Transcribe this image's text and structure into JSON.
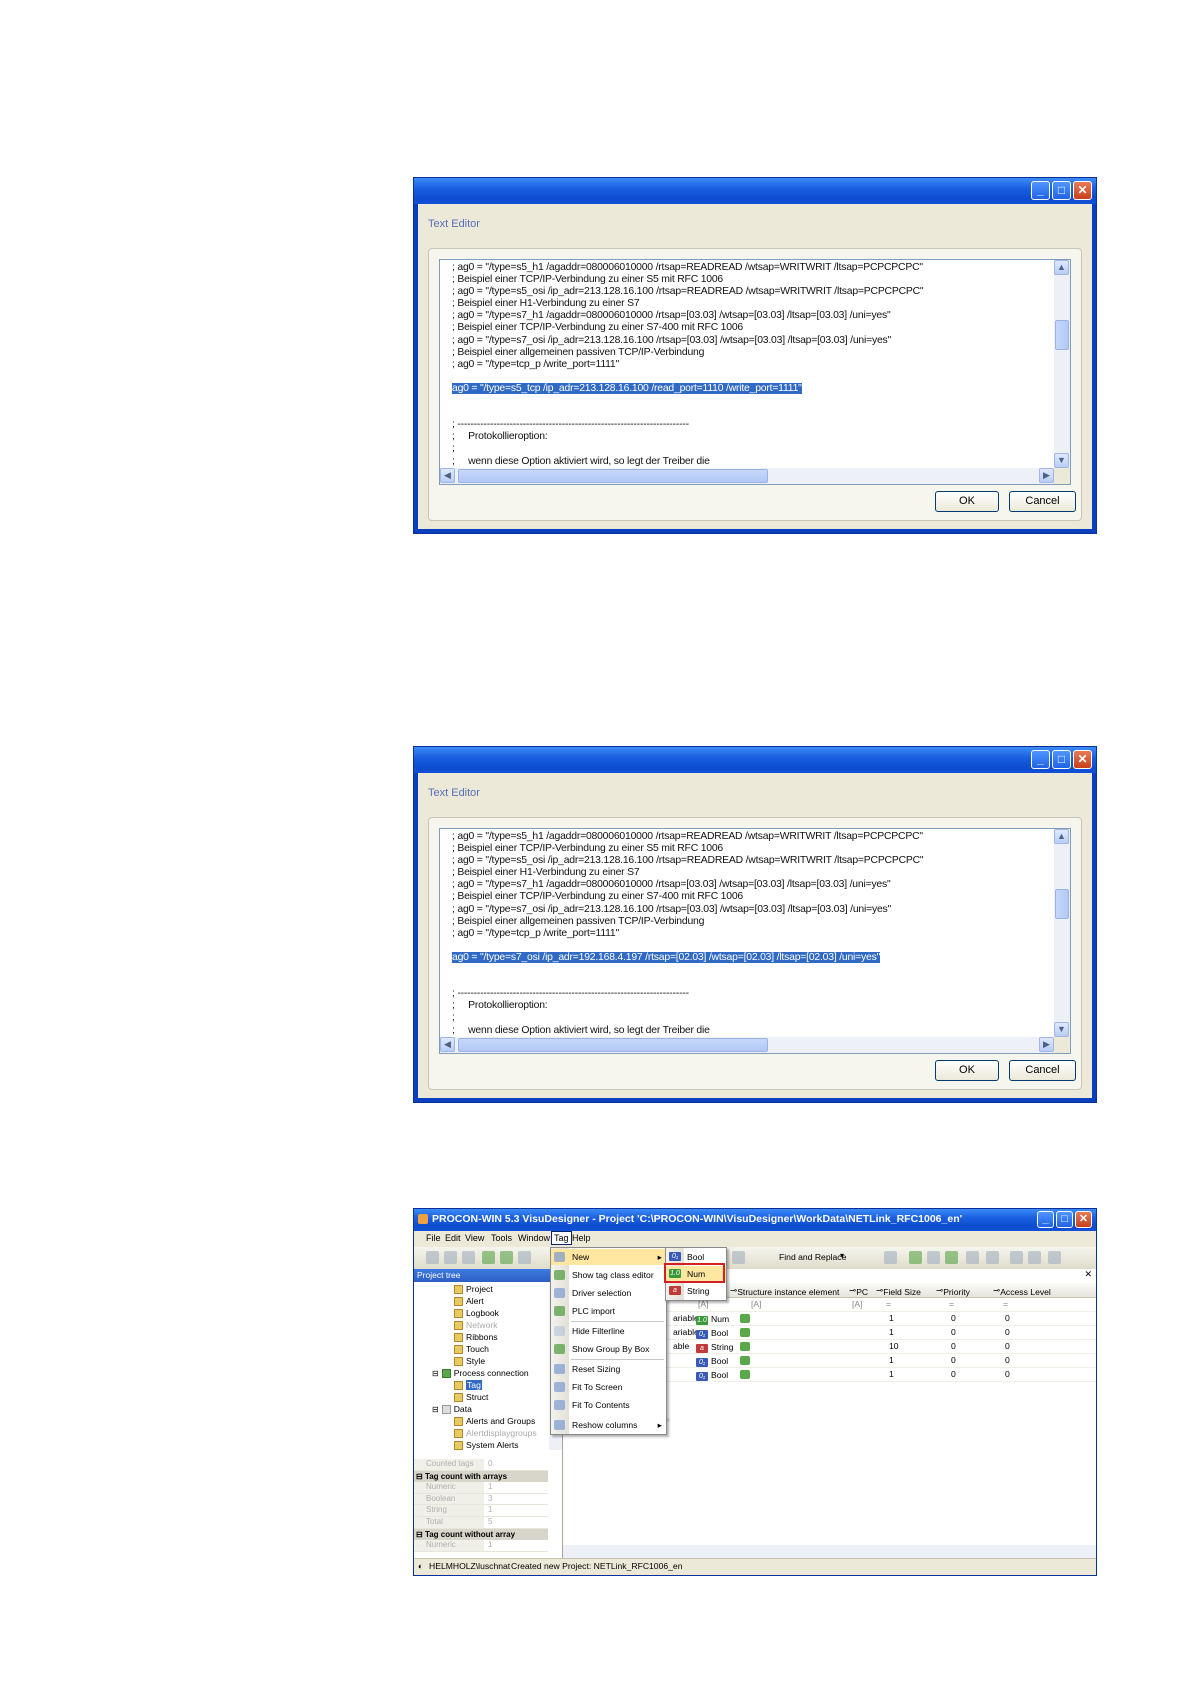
{
  "editor_dialogs": [
    {
      "dialog_title": "Text Editor",
      "lines": [
        "; ag0 = \"/type=s5_h1 /agaddr=080006010000 /rtsap=READREAD /wtsap=WRITWRIT /ltsap=PCPCPCPC\"",
        "; Beispiel einer TCP/IP-Verbindung zu einer S5 mit RFC 1006",
        "; ag0 = \"/type=s5_osi /ip_adr=213.128.16.100 /rtsap=READREAD /wtsap=WRITWRIT /ltsap=PCPCPCPC\"",
        "; Beispiel einer H1-Verbindung zu einer S7",
        "; ag0 = \"/type=s7_h1 /agaddr=080006010000 /rtsap=[03.03] /wtsap=[03.03] /ltsap=[03.03] /uni=yes\"",
        "; Beispiel einer TCP/IP-Verbindung zu einer S7-400 mit RFC 1006",
        "; ag0 = \"/type=s7_osi /ip_adr=213.128.16.100 /rtsap=[03.03] /wtsap=[03.03] /ltsap=[03.03] /uni=yes\"",
        "; Beispiel einer allgemeinen passiven TCP/IP-Verbindung",
        "; ag0 = \"/type=tcp_p /write_port=1111\""
      ],
      "selected_line": "ag0 = \"/type=s5_tcp /ip_adr=213.128.16.100 /read_port=1110 /write_port=1111\"",
      "separator": "; -----------------------------------------------------------------------",
      "tail_lines": [
        ";     Protokollieroption:",
        ";",
        ";     wenn diese Option aktiviert wird, so legt der Treiber die"
      ],
      "ok_label": "OK",
      "cancel_label": "Cancel"
    },
    {
      "dialog_title": "Text Editor",
      "lines": [
        "; ag0 = \"/type=s5_h1 /agaddr=080006010000 /rtsap=READREAD /wtsap=WRITWRIT /ltsap=PCPCPCPC\"",
        "; Beispiel einer TCP/IP-Verbindung zu einer S5 mit RFC 1006",
        "; ag0 = \"/type=s5_osi /ip_adr=213.128.16.100 /rtsap=READREAD /wtsap=WRITWRIT /ltsap=PCPCPCPC\"",
        "; Beispiel einer H1-Verbindung zu einer S7",
        "; ag0 = \"/type=s7_h1 /agaddr=080006010000 /rtsap=[03.03] /wtsap=[03.03] /ltsap=[03.03] /uni=yes\"",
        "; Beispiel einer TCP/IP-Verbindung zu einer S7-400 mit RFC 1006",
        "; ag0 = \"/type=s7_osi /ip_adr=213.128.16.100 /rtsap=[03.03] /wtsap=[03.03] /ltsap=[03.03] /uni=yes\"",
        "; Beispiel einer allgemeinen passiven TCP/IP-Verbindung",
        "; ag0 = \"/type=tcp_p /write_port=1111\""
      ],
      "selected_line": "ag0 = \"/type=s7_osi /ip_adr=192.168.4.197 /rtsap=[02.03] /wtsap=[02.03] /ltsap=[02.03] /uni=yes\"",
      "separator": "; -----------------------------------------------------------------------",
      "tail_lines": [
        ";     Protokollieroption:",
        ";",
        ";     wenn diese Option aktiviert wird, so legt der Treiber die"
      ],
      "ok_label": "OK",
      "cancel_label": "Cancel"
    }
  ],
  "app": {
    "title": "PROCON-WIN 5.3 VisuDesigner - Project 'C:\\PROCON-WIN\\VisuDesigner\\WorkData\\NETLink_RFC1006_en'",
    "menu": [
      "File",
      "Edit",
      "View",
      "Tools",
      "Window",
      "Tag",
      "Help"
    ],
    "toolbar": {
      "find_replace": "Find and Replace"
    },
    "project_tree": {
      "header": "Project tree",
      "items": [
        "Project",
        "Alert",
        "Logbook",
        "Network",
        "Ribbons",
        "Touch",
        "Style",
        "Process connection",
        "Tag",
        "Struct",
        "Data",
        "Alerts and Groups",
        "Alertdisplaygroups",
        "System Alerts"
      ]
    },
    "properties": {
      "counted_tags_label": "Counted tags",
      "counted_tags_value": "0",
      "with_arrays": "Tag count with arrays",
      "numeric": "Numeric",
      "numeric_v": "1",
      "boolean": "Boolean",
      "boolean_v": "3",
      "string": "String",
      "string_v": "1",
      "total": "Total",
      "total_v": "5",
      "without_array": "Tag count without array",
      "numeric2": "Numeric",
      "numeric2_v": "1"
    },
    "tag_menu": [
      "New",
      "Show tag class editor",
      "Driver selection",
      "PLC import",
      "Hide Filterline",
      "Show Group By Box",
      "Reset Sizing",
      "Fit To Screen",
      "Fit To Contents",
      "Reshow columns"
    ],
    "new_submenu": [
      "Bool",
      "Num",
      "String"
    ],
    "grid": {
      "columns": [
        "Structure instance element",
        "PC",
        "Field Size",
        "Priority",
        "Access Level"
      ],
      "rows": [
        {
          "prefix": "ariable",
          "type": "Num",
          "field_size": "1",
          "priority": "0",
          "access": "0"
        },
        {
          "prefix": "ariable",
          "type": "Bool",
          "field_size": "1",
          "priority": "0",
          "access": "0"
        },
        {
          "prefix": "able",
          "type": "String",
          "field_size": "10",
          "priority": "0",
          "access": "0"
        },
        {
          "prefix": "",
          "type": "Bool",
          "field_size": "1",
          "priority": "0",
          "access": "0"
        },
        {
          "prefix": "",
          "type": "Bool",
          "field_size": "1",
          "priority": "0",
          "access": "0"
        }
      ]
    },
    "status": {
      "user": "HELMHOLZ\\luschnat",
      "message": "Created new Project: NETLink_RFC1006_en"
    },
    "colors": {
      "title_blue": "#1a5fe0",
      "selection": "#316ac5",
      "highlight_box": "#d42020"
    }
  }
}
